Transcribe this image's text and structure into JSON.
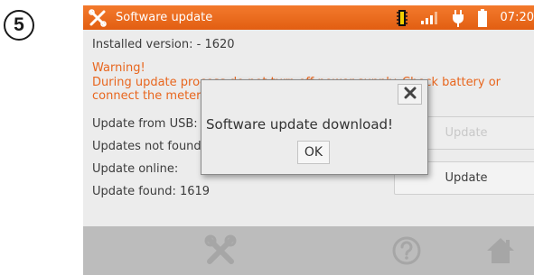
{
  "step_badge": "5",
  "header": {
    "title": "Software update",
    "clock": "07:20",
    "icons": [
      "tools-icon",
      "memory-chip-icon",
      "signal-bars-icon",
      "plug-icon",
      "battery-icon"
    ]
  },
  "info": {
    "installed": "Installed version: - 1620",
    "warning_title": "Warning!",
    "warning_line1": "During update process do not turn off power supply. Check battery or",
    "warning_line2": "connect the meter",
    "usb_label": "Update from USB:",
    "usb_status": "Updates not found",
    "online_label": "Update online:",
    "online_status": "Update found: 1619"
  },
  "buttons": {
    "usb_update": "Update",
    "online_update": "Update"
  },
  "dialog": {
    "message": "Software update download!",
    "ok": "OK"
  },
  "bottom_icons": [
    "settings-tools-icon",
    "help-icon",
    "home-icon"
  ],
  "colors": {
    "accent": "#e8661e",
    "titlebar": "#ee6b1f",
    "bottom_bar": "#bcbcbc"
  }
}
